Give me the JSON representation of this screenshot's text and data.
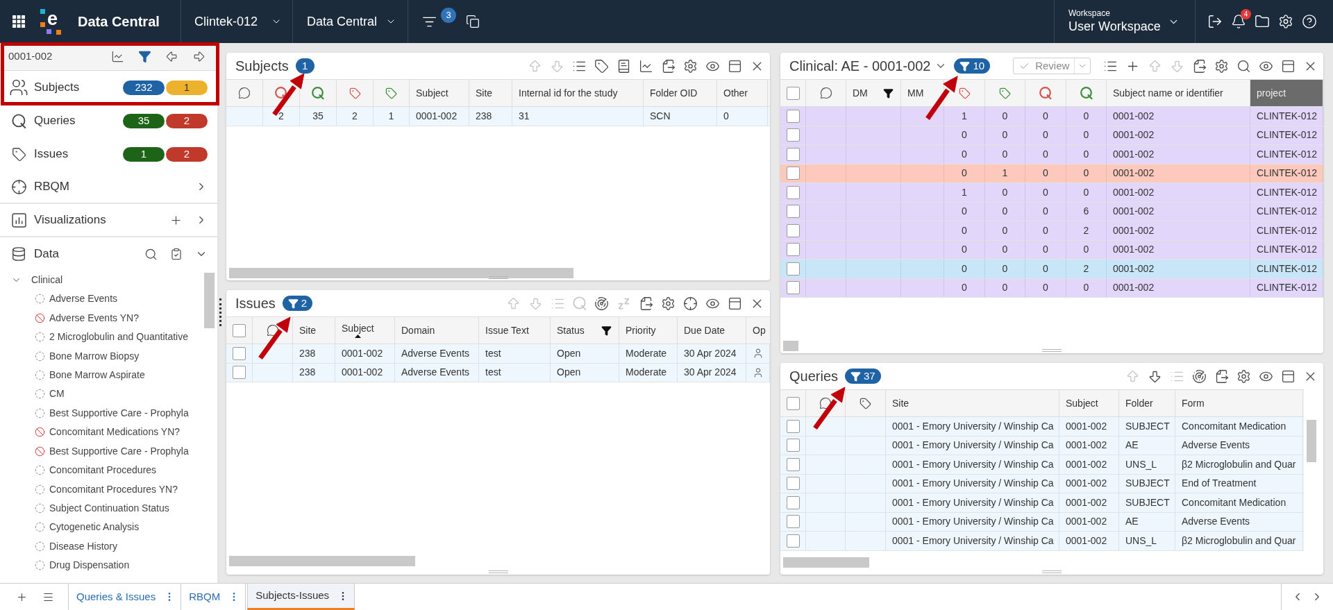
{
  "topbar": {
    "logo_mark": "e",
    "app_title": "Data Central",
    "study": "Clintek-012",
    "module": "Data Central",
    "filter_count": "3",
    "workspace_label": "Workspace",
    "workspace": "User Workspace",
    "notification_count": "4"
  },
  "sidebar": {
    "subject_id": "0001-002",
    "filter_active": true,
    "nav": [
      {
        "kind": "counts",
        "label": "Subjects",
        "counts": [
          {
            "value": "232",
            "color": "#1f63a5"
          },
          {
            "value": "1",
            "color": "#ecb22e"
          }
        ]
      },
      {
        "kind": "counts",
        "label": "Queries",
        "counts": [
          {
            "value": "35",
            "color": "#1d6318"
          },
          {
            "value": "2",
            "color": "#c0392b"
          }
        ]
      },
      {
        "kind": "counts",
        "label": "Issues",
        "counts": [
          {
            "value": "1",
            "color": "#1d6318"
          },
          {
            "value": "2",
            "color": "#c0392b"
          }
        ]
      },
      {
        "kind": "link",
        "label": "RBQM",
        "expanded": false
      },
      {
        "kind": "add",
        "label": "Visualizations",
        "expanded": false
      },
      {
        "kind": "search",
        "label": "Data",
        "expanded": true
      }
    ],
    "tree": [
      {
        "label": "Clinical",
        "expanded": true,
        "children": [
          {
            "label": "Adverse Events",
            "blocked": false
          },
          {
            "label": "Adverse Events YN?",
            "blocked": true
          },
          {
            "label": "2 Microglobulin and Quantitative",
            "blocked": false
          },
          {
            "label": "Bone Marrow Biopsy",
            "blocked": false
          },
          {
            "label": "Bone Marrow Aspirate",
            "blocked": false
          },
          {
            "label": "CM",
            "blocked": false
          },
          {
            "label": "Best Supportive Care - Prophyla",
            "blocked": false
          },
          {
            "label": "Concomitant Medications YN?",
            "blocked": true
          },
          {
            "label": "Best Supportive Care - Prophyla",
            "blocked": true
          },
          {
            "label": "Concomitant Procedures",
            "blocked": false
          },
          {
            "label": "Concomitant Procedures YN?",
            "blocked": false
          },
          {
            "label": "Subject Continuation Status",
            "blocked": false
          },
          {
            "label": "Cytogenetic Analysis",
            "blocked": false
          },
          {
            "label": "Disease History",
            "blocked": false
          },
          {
            "label": "Drug Dispensation",
            "blocked": false
          }
        ]
      }
    ]
  },
  "subjects": {
    "title": "Subjects",
    "badge": {
      "filtered": false,
      "count": "1"
    },
    "toolbar": [
      {
        "kind": "up",
        "disabled": true
      },
      {
        "kind": "down",
        "disabled": true
      },
      {
        "kind": "list",
        "disabled": false
      },
      {
        "kind": "tag",
        "disabled": false
      },
      {
        "kind": "book",
        "disabled": false
      },
      {
        "kind": "chart",
        "disabled": false
      },
      {
        "kind": "export",
        "disabled": false
      },
      {
        "kind": "settings",
        "disabled": false
      },
      {
        "kind": "view",
        "disabled": false
      },
      {
        "kind": "layout",
        "disabled": false
      },
      {
        "kind": "close",
        "disabled": false
      }
    ],
    "table": {
      "columns": [
        {
          "kind": "comment"
        },
        {
          "kind": "query",
          "color": "#d9534f"
        },
        {
          "kind": "query",
          "color": "#3c8d3c"
        },
        {
          "kind": "tag",
          "color": "#d9534f"
        },
        {
          "kind": "tag",
          "color": "#3c8d3c"
        },
        {
          "kind": "text",
          "label": "Subject"
        },
        {
          "kind": "text",
          "label": "Site"
        },
        {
          "kind": "text",
          "label": "Internal id for the study"
        },
        {
          "kind": "text",
          "label": "Folder OID"
        },
        {
          "kind": "text",
          "label": "Other"
        }
      ],
      "rows": [
        {
          "cells": [
            null,
            "2",
            "35",
            "2",
            "1",
            "0001-002",
            "238",
            "31",
            "SCN",
            "0"
          ]
        }
      ]
    }
  },
  "issues": {
    "title": "Issues",
    "badge": {
      "filtered": true,
      "count": "2"
    },
    "toolbar": [
      {
        "kind": "up",
        "disabled": true
      },
      {
        "kind": "down",
        "disabled": true
      },
      {
        "kind": "list",
        "disabled": true
      },
      {
        "kind": "query",
        "disabled": true
      },
      {
        "kind": "radar",
        "disabled": false
      },
      {
        "kind": "sleep",
        "disabled": true
      },
      {
        "kind": "export",
        "disabled": false
      },
      {
        "kind": "settings",
        "disabled": false
      },
      {
        "kind": "target",
        "disabled": false
      },
      {
        "kind": "view",
        "disabled": false
      },
      {
        "kind": "layout",
        "disabled": false
      },
      {
        "kind": "close",
        "disabled": false
      }
    ],
    "table": {
      "all_checked": false,
      "columns": [
        {
          "kind": "check"
        },
        {
          "kind": "comment"
        },
        {
          "kind": "text",
          "label": "Site",
          "filtered": false
        },
        {
          "kind": "text",
          "label": "Subject",
          "filtered": false,
          "sorted_ascending": true
        },
        {
          "kind": "text",
          "label": "Domain",
          "filtered": false
        },
        {
          "kind": "text",
          "label": "Issue Text",
          "filtered": false
        },
        {
          "kind": "text",
          "label": "Status",
          "filtered": true
        },
        {
          "kind": "text",
          "label": "Priority",
          "filtered": false
        },
        {
          "kind": "text",
          "label": "Due Date",
          "filtered": false
        },
        {
          "kind": "user",
          "label": "Op"
        }
      ],
      "rows": [
        {
          "checked": false,
          "cells": [
            null,
            null,
            "238",
            "0001-002",
            "Adverse Events",
            "test",
            "Open",
            "Moderate",
            "30 Apr 2024",
            null
          ]
        },
        {
          "checked": false,
          "cells": [
            null,
            null,
            "238",
            "0001-002",
            "Adverse Events",
            "test",
            "Open",
            "Moderate",
            "30 Apr 2024",
            null
          ]
        }
      ]
    }
  },
  "clinical": {
    "title": "Clinical: AE - 0001-002",
    "title_menu": true,
    "badge": {
      "filtered": true,
      "count": "10"
    },
    "review_button": {
      "label": "Review",
      "disabled": true
    },
    "toolbar": [
      {
        "kind": "list",
        "disabled": false
      },
      {
        "kind": "add",
        "disabled": false
      },
      {
        "kind": "up",
        "disabled": true
      },
      {
        "kind": "down",
        "disabled": true
      },
      {
        "kind": "export",
        "disabled": false
      },
      {
        "kind": "settings",
        "disabled": false
      },
      {
        "kind": "search",
        "disabled": false
      },
      {
        "kind": "view",
        "disabled": false
      },
      {
        "kind": "layout",
        "disabled": false
      },
      {
        "kind": "close",
        "disabled": false
      }
    ],
    "table": {
      "all_checked": false,
      "columns": [
        {
          "kind": "check"
        },
        {
          "kind": "comment"
        },
        {
          "kind": "text",
          "label": "DM",
          "filtered": true,
          "selected": false
        },
        {
          "kind": "text",
          "label": "MM",
          "filtered": false,
          "selected": false
        },
        {
          "kind": "tag",
          "color": "#d9534f"
        },
        {
          "kind": "tag",
          "color": "#3c8d3c"
        },
        {
          "kind": "query",
          "color": "#d9534f"
        },
        {
          "kind": "query",
          "color": "#3c8d3c"
        },
        {
          "kind": "text",
          "label": "Subject name or identifier",
          "filtered": false,
          "selected": false
        },
        {
          "kind": "text",
          "label": "project",
          "filtered": false,
          "selected": true
        }
      ],
      "rows": [
        {
          "checked": false,
          "color": "#e2d6fb",
          "cells": [
            null,
            null,
            null,
            null,
            "1",
            "0",
            "0",
            "0",
            "0001-002",
            "CLINTEK-012"
          ]
        },
        {
          "checked": false,
          "color": "#e2d6fb",
          "cells": [
            null,
            null,
            null,
            null,
            "0",
            "0",
            "0",
            "0",
            "0001-002",
            "CLINTEK-012"
          ]
        },
        {
          "checked": false,
          "color": "#e2d6fb",
          "cells": [
            null,
            null,
            null,
            null,
            "0",
            "0",
            "0",
            "0",
            "0001-002",
            "CLINTEK-012"
          ]
        },
        {
          "checked": false,
          "color": "#fcc9bc",
          "cells": [
            null,
            null,
            null,
            null,
            "0",
            "1",
            "0",
            "0",
            "0001-002",
            "CLINTEK-012"
          ]
        },
        {
          "checked": false,
          "color": "#e2d6fb",
          "cells": [
            null,
            null,
            null,
            null,
            "1",
            "0",
            "0",
            "0",
            "0001-002",
            "CLINTEK-012"
          ]
        },
        {
          "checked": false,
          "color": "#e2d6fb",
          "cells": [
            null,
            null,
            null,
            null,
            "0",
            "0",
            "0",
            "6",
            "0001-002",
            "CLINTEK-012"
          ]
        },
        {
          "checked": false,
          "color": "#e2d6fb",
          "cells": [
            null,
            null,
            null,
            null,
            "0",
            "0",
            "0",
            "2",
            "0001-002",
            "CLINTEK-012"
          ]
        },
        {
          "checked": false,
          "color": "#e2d6fb",
          "cells": [
            null,
            null,
            null,
            null,
            "0",
            "0",
            "0",
            "0",
            "0001-002",
            "CLINTEK-012"
          ]
        },
        {
          "checked": false,
          "color": "#c8e6f7",
          "cells": [
            null,
            null,
            null,
            null,
            "0",
            "0",
            "0",
            "2",
            "0001-002",
            "CLINTEK-012"
          ]
        },
        {
          "checked": false,
          "color": "#e2d6fb",
          "cells": [
            null,
            null,
            null,
            null,
            "0",
            "0",
            "0",
            "0",
            "0001-002",
            "CLINTEK-012"
          ]
        }
      ]
    }
  },
  "queries": {
    "title": "Queries",
    "badge": {
      "filtered": true,
      "count": "37"
    },
    "toolbar": [
      {
        "kind": "up",
        "disabled": true
      },
      {
        "kind": "down",
        "disabled": false
      },
      {
        "kind": "list",
        "disabled": true
      },
      {
        "kind": "radar",
        "disabled": false
      },
      {
        "kind": "export",
        "disabled": false
      },
      {
        "kind": "settings",
        "disabled": false
      },
      {
        "kind": "view",
        "disabled": false
      },
      {
        "kind": "layout",
        "disabled": false
      },
      {
        "kind": "close",
        "disabled": false
      }
    ],
    "table": {
      "all_checked": false,
      "columns": [
        {
          "kind": "check"
        },
        {
          "kind": "comment"
        },
        {
          "kind": "tag",
          "color": "#555555"
        },
        {
          "kind": "text",
          "label": "Site"
        },
        {
          "kind": "text",
          "label": "Subject"
        },
        {
          "kind": "text",
          "label": "Folder"
        },
        {
          "kind": "text",
          "label": "Form"
        }
      ],
      "rows": [
        {
          "checked": false,
          "cells": [
            null,
            null,
            null,
            "0001 - Emory University / Winship Ca",
            "0001-002",
            "SUBJECT",
            "Concomitant Medication"
          ]
        },
        {
          "checked": false,
          "cells": [
            null,
            null,
            null,
            "0001 - Emory University / Winship Ca",
            "0001-002",
            "AE",
            "Adverse Events"
          ]
        },
        {
          "checked": false,
          "cells": [
            null,
            null,
            null,
            "0001 - Emory University / Winship Ca",
            "0001-002",
            "UNS_L",
            "β2 Microglobulin and Quar"
          ]
        },
        {
          "checked": false,
          "cells": [
            null,
            null,
            null,
            "0001 - Emory University / Winship Ca",
            "0001-002",
            "SUBJECT",
            "End of Treatment"
          ]
        },
        {
          "checked": false,
          "cells": [
            null,
            null,
            null,
            "0001 - Emory University / Winship Ca",
            "0001-002",
            "SUBJECT",
            "Concomitant Medication"
          ]
        },
        {
          "checked": false,
          "cells": [
            null,
            null,
            null,
            "0001 - Emory University / Winship Ca",
            "0001-002",
            "AE",
            "Adverse Events"
          ]
        },
        {
          "checked": false,
          "cells": [
            null,
            null,
            null,
            "0001 - Emory University / Winship Ca",
            "0001-002",
            "UNS_L",
            "β2 Microglobulin and Quar"
          ]
        }
      ]
    }
  },
  "bottom_tabs": [
    {
      "label": "Queries & Issues",
      "selected": false
    },
    {
      "label": "RBQM",
      "selected": false
    },
    {
      "label": "Subjects-Issues",
      "selected": true
    }
  ]
}
